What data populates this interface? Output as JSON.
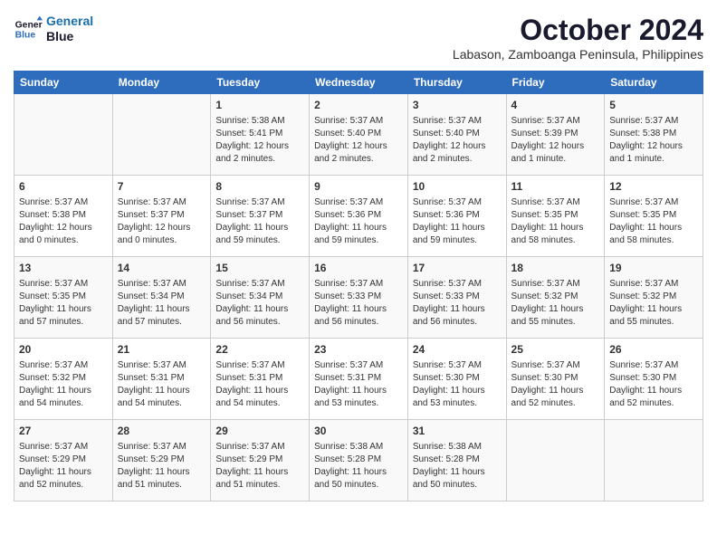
{
  "header": {
    "logo_line1": "General",
    "logo_line2": "Blue",
    "month": "October 2024",
    "location": "Labason, Zamboanga Peninsula, Philippines"
  },
  "days_of_week": [
    "Sunday",
    "Monday",
    "Tuesday",
    "Wednesday",
    "Thursday",
    "Friday",
    "Saturday"
  ],
  "weeks": [
    [
      {
        "day": "",
        "info": ""
      },
      {
        "day": "",
        "info": ""
      },
      {
        "day": "1",
        "info": "Sunrise: 5:38 AM\nSunset: 5:41 PM\nDaylight: 12 hours\nand 2 minutes."
      },
      {
        "day": "2",
        "info": "Sunrise: 5:37 AM\nSunset: 5:40 PM\nDaylight: 12 hours\nand 2 minutes."
      },
      {
        "day": "3",
        "info": "Sunrise: 5:37 AM\nSunset: 5:40 PM\nDaylight: 12 hours\nand 2 minutes."
      },
      {
        "day": "4",
        "info": "Sunrise: 5:37 AM\nSunset: 5:39 PM\nDaylight: 12 hours\nand 1 minute."
      },
      {
        "day": "5",
        "info": "Sunrise: 5:37 AM\nSunset: 5:38 PM\nDaylight: 12 hours\nand 1 minute."
      }
    ],
    [
      {
        "day": "6",
        "info": "Sunrise: 5:37 AM\nSunset: 5:38 PM\nDaylight: 12 hours\nand 0 minutes."
      },
      {
        "day": "7",
        "info": "Sunrise: 5:37 AM\nSunset: 5:37 PM\nDaylight: 12 hours\nand 0 minutes."
      },
      {
        "day": "8",
        "info": "Sunrise: 5:37 AM\nSunset: 5:37 PM\nDaylight: 11 hours\nand 59 minutes."
      },
      {
        "day": "9",
        "info": "Sunrise: 5:37 AM\nSunset: 5:36 PM\nDaylight: 11 hours\nand 59 minutes."
      },
      {
        "day": "10",
        "info": "Sunrise: 5:37 AM\nSunset: 5:36 PM\nDaylight: 11 hours\nand 59 minutes."
      },
      {
        "day": "11",
        "info": "Sunrise: 5:37 AM\nSunset: 5:35 PM\nDaylight: 11 hours\nand 58 minutes."
      },
      {
        "day": "12",
        "info": "Sunrise: 5:37 AM\nSunset: 5:35 PM\nDaylight: 11 hours\nand 58 minutes."
      }
    ],
    [
      {
        "day": "13",
        "info": "Sunrise: 5:37 AM\nSunset: 5:35 PM\nDaylight: 11 hours\nand 57 minutes."
      },
      {
        "day": "14",
        "info": "Sunrise: 5:37 AM\nSunset: 5:34 PM\nDaylight: 11 hours\nand 57 minutes."
      },
      {
        "day": "15",
        "info": "Sunrise: 5:37 AM\nSunset: 5:34 PM\nDaylight: 11 hours\nand 56 minutes."
      },
      {
        "day": "16",
        "info": "Sunrise: 5:37 AM\nSunset: 5:33 PM\nDaylight: 11 hours\nand 56 minutes."
      },
      {
        "day": "17",
        "info": "Sunrise: 5:37 AM\nSunset: 5:33 PM\nDaylight: 11 hours\nand 56 minutes."
      },
      {
        "day": "18",
        "info": "Sunrise: 5:37 AM\nSunset: 5:32 PM\nDaylight: 11 hours\nand 55 minutes."
      },
      {
        "day": "19",
        "info": "Sunrise: 5:37 AM\nSunset: 5:32 PM\nDaylight: 11 hours\nand 55 minutes."
      }
    ],
    [
      {
        "day": "20",
        "info": "Sunrise: 5:37 AM\nSunset: 5:32 PM\nDaylight: 11 hours\nand 54 minutes."
      },
      {
        "day": "21",
        "info": "Sunrise: 5:37 AM\nSunset: 5:31 PM\nDaylight: 11 hours\nand 54 minutes."
      },
      {
        "day": "22",
        "info": "Sunrise: 5:37 AM\nSunset: 5:31 PM\nDaylight: 11 hours\nand 54 minutes."
      },
      {
        "day": "23",
        "info": "Sunrise: 5:37 AM\nSunset: 5:31 PM\nDaylight: 11 hours\nand 53 minutes."
      },
      {
        "day": "24",
        "info": "Sunrise: 5:37 AM\nSunset: 5:30 PM\nDaylight: 11 hours\nand 53 minutes."
      },
      {
        "day": "25",
        "info": "Sunrise: 5:37 AM\nSunset: 5:30 PM\nDaylight: 11 hours\nand 52 minutes."
      },
      {
        "day": "26",
        "info": "Sunrise: 5:37 AM\nSunset: 5:30 PM\nDaylight: 11 hours\nand 52 minutes."
      }
    ],
    [
      {
        "day": "27",
        "info": "Sunrise: 5:37 AM\nSunset: 5:29 PM\nDaylight: 11 hours\nand 52 minutes."
      },
      {
        "day": "28",
        "info": "Sunrise: 5:37 AM\nSunset: 5:29 PM\nDaylight: 11 hours\nand 51 minutes."
      },
      {
        "day": "29",
        "info": "Sunrise: 5:37 AM\nSunset: 5:29 PM\nDaylight: 11 hours\nand 51 minutes."
      },
      {
        "day": "30",
        "info": "Sunrise: 5:38 AM\nSunset: 5:28 PM\nDaylight: 11 hours\nand 50 minutes."
      },
      {
        "day": "31",
        "info": "Sunrise: 5:38 AM\nSunset: 5:28 PM\nDaylight: 11 hours\nand 50 minutes."
      },
      {
        "day": "",
        "info": ""
      },
      {
        "day": "",
        "info": ""
      }
    ]
  ]
}
